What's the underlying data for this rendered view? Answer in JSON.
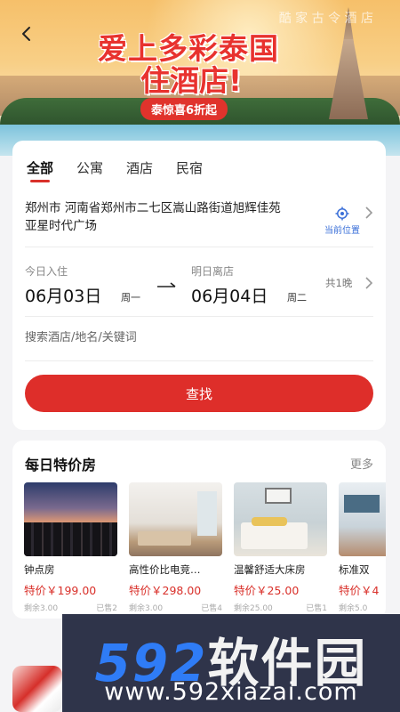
{
  "banner": {
    "top_text": "酷 家 古 令 酒 店",
    "title_line1": "爱上多彩泰国",
    "title_line2": "住酒店!",
    "promo": "泰惊喜6折起"
  },
  "tabs": [
    {
      "label": "全部",
      "active": true
    },
    {
      "label": "公寓",
      "active": false
    },
    {
      "label": "酒店",
      "active": false
    },
    {
      "label": "民宿",
      "active": false
    }
  ],
  "address": {
    "text": "郑州市  河南省郑州市二七区嵩山路街道旭辉佳苑亚星时代广场",
    "locate_label": "当前位置"
  },
  "dates": {
    "checkin_label": "今日入住",
    "checkin_date": "06月03日",
    "checkin_weekday": "周一",
    "checkout_label": "明日离店",
    "checkout_date": "06月04日",
    "checkout_weekday": "周二",
    "nights": "共1晚"
  },
  "keyword": {
    "placeholder": "搜索酒店/地名/关键词"
  },
  "search_button": "查找",
  "deals": {
    "title": "每日特价房",
    "more": "更多",
    "items": [
      {
        "name": "钟点房",
        "price": "特价￥199.00",
        "remaining": "剩余3.00",
        "sold": "已售2"
      },
      {
        "name": "高性价比电竞…",
        "price": "特价￥298.00",
        "remaining": "剩余3.00",
        "sold": "已售4"
      },
      {
        "name": "温馨舒适大床房",
        "price": "特价￥25.00",
        "remaining": "剩余25.00",
        "sold": "已售1"
      },
      {
        "name": "标准双",
        "price": "特价￥4",
        "remaining": "剩余5.0",
        "sold": ""
      }
    ]
  },
  "watermark": {
    "digits": "592",
    "brand": "软件园",
    "url": "www.592xiazai.com"
  },
  "colors": {
    "accent": "#de2e2a",
    "link_blue": "#3a6fd8"
  }
}
